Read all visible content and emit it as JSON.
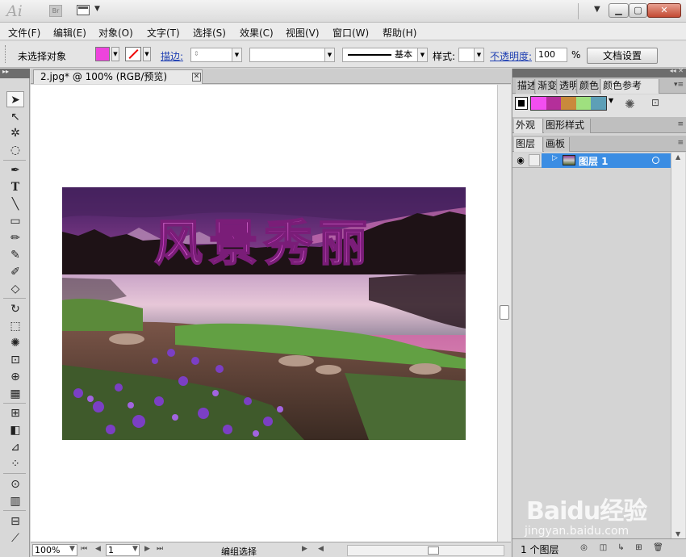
{
  "app": {
    "logo": "Ai",
    "bridge_label": "Br"
  },
  "menu": [
    "文件(F)",
    "编辑(E)",
    "对象(O)",
    "文字(T)",
    "选择(S)",
    "效果(C)",
    "视图(V)",
    "窗口(W)",
    "帮助(H)"
  ],
  "control": {
    "selection_status": "未选择对象",
    "fill_color": "#ee44dd",
    "stroke_label": "描边:",
    "stroke_style_label": "基本",
    "style_label": "样式:",
    "opacity_label": "不透明度:",
    "opacity_value": "100",
    "opacity_unit": "%",
    "doc_setup_button": "文档设置"
  },
  "document": {
    "tab_title": "2.jpg* @ 100% (RGB/预览)",
    "tab_close": "✕",
    "artwork_text": "风景秀丽"
  },
  "status": {
    "zoom": "100%",
    "page": "1",
    "tool_status": "编组选择"
  },
  "panels": {
    "top_tabs": [
      "描述",
      "渐变",
      "透明",
      "颜色",
      "颜色参考"
    ],
    "mid_tabs": [
      "外观",
      "图形样式"
    ],
    "layer_tabs": [
      "图层",
      "画板"
    ],
    "color_guide_colors": [
      "#f24ef0",
      "#b42f9a",
      "#c98a3c",
      "#9fe07f",
      "#5d9fb7"
    ],
    "layers": [
      {
        "name": "图层 1",
        "selected": true
      }
    ],
    "layer_count": "1 个图层"
  },
  "watermark": {
    "brand": "Baidu经验",
    "url": "jingyan.baidu.com"
  }
}
